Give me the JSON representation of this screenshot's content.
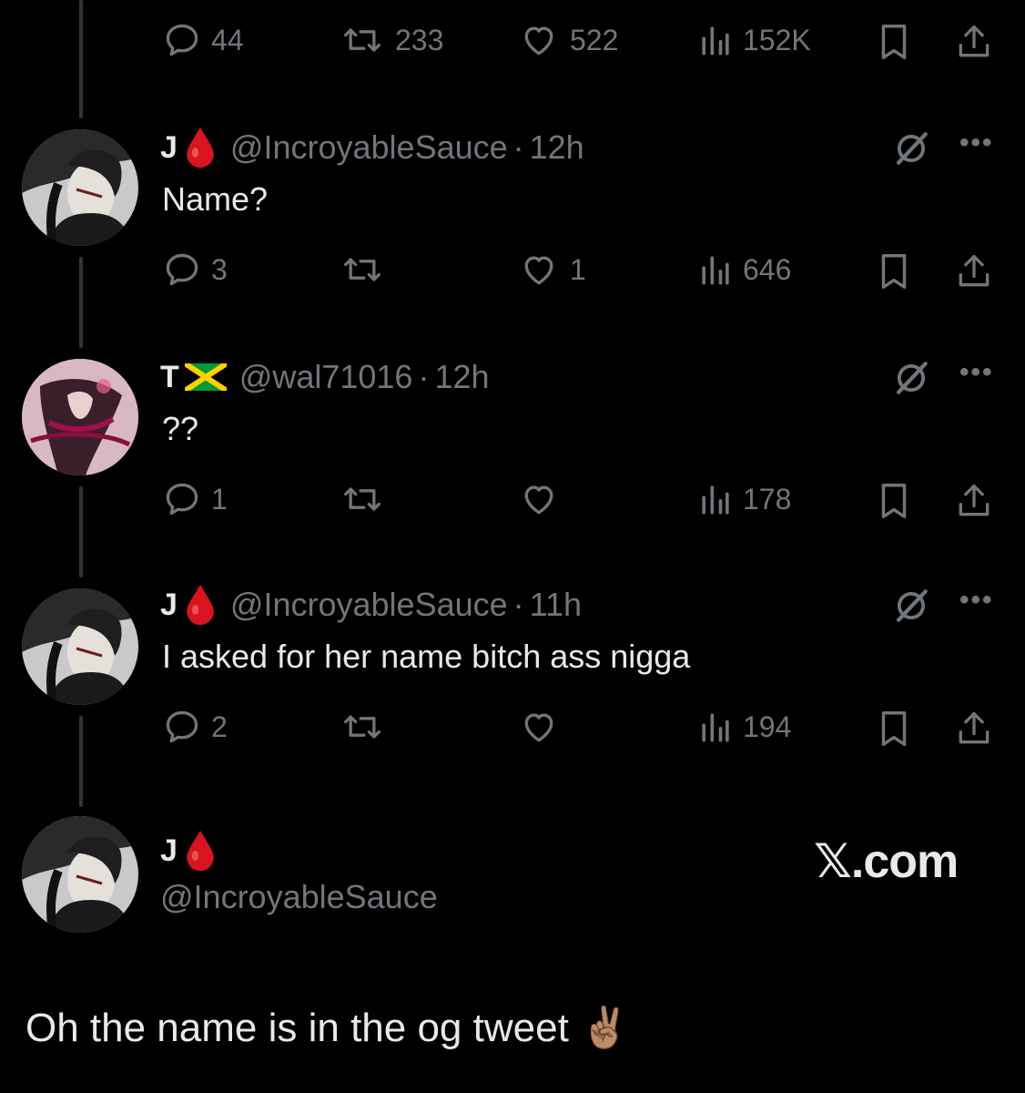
{
  "colors": {
    "background": "#000000",
    "text": "#e7e9ea",
    "muted": "#71767b",
    "thread_line": "#333639"
  },
  "top_actions": {
    "replies": "44",
    "reposts": "233",
    "likes": "522",
    "views": "152K"
  },
  "replies": [
    {
      "display_name": "J",
      "badge_icon": "blood-drop-icon",
      "handle": "@IncroyableSauce",
      "separator": "·",
      "time": "12h",
      "text": "Name?",
      "stats": {
        "replies": "3",
        "reposts": "",
        "likes": "1",
        "views": "646"
      }
    },
    {
      "display_name": "T",
      "badge_icon": "jamaica-flag-icon",
      "handle": "@wal71016",
      "separator": "·",
      "time": "12h",
      "text": "??",
      "stats": {
        "replies": "1",
        "reposts": "",
        "likes": "",
        "views": "178"
      }
    },
    {
      "display_name": "J",
      "badge_icon": "blood-drop-icon",
      "handle": "@IncroyableSauce",
      "separator": "·",
      "time": "11h",
      "text": "I asked for her name bitch ass nigga",
      "stats": {
        "replies": "2",
        "reposts": "",
        "likes": "",
        "views": "194"
      }
    }
  ],
  "quoted": {
    "display_name": "J",
    "badge_icon": "blood-drop-icon",
    "handle": "@IncroyableSauce",
    "brand": "𝕏.com",
    "text": "Oh the name is in the og tweet ✌🏽"
  }
}
